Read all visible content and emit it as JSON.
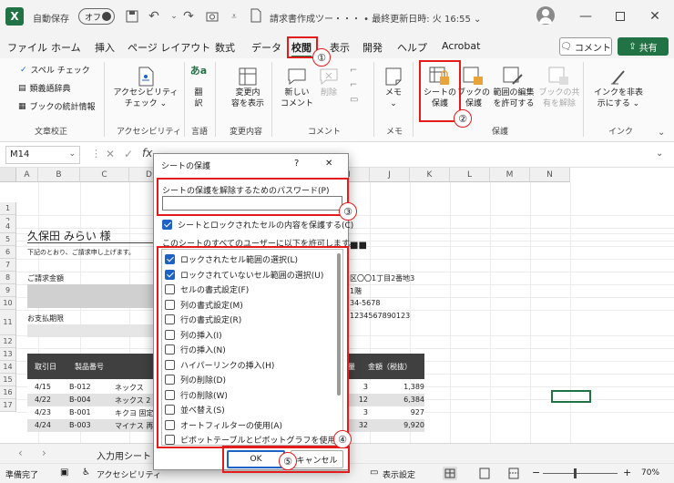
{
  "titlebar": {
    "autosave_label": "自動保存",
    "autosave_state": "オフ",
    "doc_title": "請求書作成ツー・・・ • 最終更新日時: 火 16:55 ⌄"
  },
  "tabs": [
    "ファイル",
    "ホーム",
    "挿入",
    "ページ レイアウト",
    "数式",
    "データ",
    "校閲",
    "表示",
    "開発",
    "ヘルプ",
    "Acrobat"
  ],
  "active_tab": "校閲",
  "comment_button": "コメント",
  "share_button": "共有",
  "ribbon": {
    "proofing": {
      "items": [
        "スペル チェック",
        "類義語辞典",
        "ブックの統計情報"
      ],
      "group": "文章校正"
    },
    "accessibility": {
      "button": "アクセシビリティ\nチェック ⌄",
      "group": "アクセシビリティ"
    },
    "language": {
      "button": "翻\n訳",
      "group": "言語"
    },
    "changes": {
      "button": "変更内\n容を表示",
      "group": "変更内容"
    },
    "comments": {
      "new": "新しい\nコメント",
      "delete": "削除",
      "group": "コメント"
    },
    "notes": {
      "button": "メモ\n⌄",
      "group": "メモ"
    },
    "protect": {
      "sheet": "シートの\n保護",
      "book": "ブックの\n保護",
      "ranges": "範囲の編集\nを許可する",
      "unshare": "ブックの共\n有を解除",
      "group": "保護"
    },
    "ink": {
      "button": "インクを非表\n示にする ⌄",
      "group": "インク"
    }
  },
  "formula": {
    "namebox": "M14",
    "fx": "fx"
  },
  "columns": [
    "A",
    "B",
    "C",
    "D",
    "E",
    "F",
    "G",
    "H",
    "I",
    "J",
    "K",
    "L",
    "M",
    "N"
  ],
  "rows": [
    "1",
    "2",
    "3",
    "4",
    "5",
    "6",
    "7",
    "8",
    "9",
    "10",
    "11",
    "12",
    "13",
    "14",
    "15",
    "16",
    "17"
  ],
  "sheet": {
    "customer": "久保田 みらい 様",
    "intro": "下記のとおり、ご請求申し上げます。",
    "amount_label": "ご請求金額",
    "due_label": "お支払期限",
    "title_partial": "■■",
    "address_partial": "区〇〇1丁目2番地3",
    "floor_partial": "1階",
    "tel_partial": "34-5678",
    "reg_partial": "1234567890123",
    "table_headers": [
      "取引日",
      "製品番号",
      "量",
      "金額（税抜）"
    ],
    "table_rows": [
      [
        "4/15",
        "B-012",
        "ネックス",
        "3",
        "1,389"
      ],
      [
        "4/22",
        "B-004",
        "ネックス 2",
        "12",
        "6,384"
      ],
      [
        "4/23",
        "B-001",
        "キクヨ 固定",
        "3",
        "927"
      ],
      [
        "4/24",
        "B-003",
        "マイナス 再",
        "32",
        "9,920"
      ]
    ]
  },
  "sheet_tab": "入力用シート",
  "status": {
    "ready": "準備完了",
    "accessibility": "アクセシビリティ",
    "display": "表示設定",
    "zoom": "70%"
  },
  "dialog": {
    "title": "シートの保護",
    "help": "?",
    "close": "✕",
    "password_label": "シートの保護を解除するためのパスワード(P)",
    "password_value": "",
    "protect_label": "シートとロックされたセルの内容を保護する(C)",
    "allow_label": "このシートのすべてのユーザーに以下を許可します。",
    "permissions": [
      {
        "label": "ロックされたセル範囲の選択(L)",
        "checked": true
      },
      {
        "label": "ロックされていないセル範囲の選択(U)",
        "checked": true
      },
      {
        "label": "セルの書式設定(F)",
        "checked": false
      },
      {
        "label": "列の書式設定(M)",
        "checked": false
      },
      {
        "label": "行の書式設定(R)",
        "checked": false
      },
      {
        "label": "列の挿入(I)",
        "checked": false
      },
      {
        "label": "行の挿入(N)",
        "checked": false
      },
      {
        "label": "ハイパーリンクの挿入(H)",
        "checked": false
      },
      {
        "label": "列の削除(D)",
        "checked": false
      },
      {
        "label": "行の削除(W)",
        "checked": false
      },
      {
        "label": "並べ替え(S)",
        "checked": false
      },
      {
        "label": "オートフィルターの使用(A)",
        "checked": false
      },
      {
        "label": "ピボットテーブルとピボットグラフを使用する",
        "checked": false
      }
    ],
    "ok": "OK",
    "cancel": "キャンセル"
  },
  "callouts": [
    "①",
    "②",
    "③",
    "④",
    "⑤"
  ],
  "colors": {
    "excel_green": "#217346",
    "highlight_red": "#e41b1b",
    "checkbox_blue": "#1d63c6",
    "table_header": "#404040"
  }
}
